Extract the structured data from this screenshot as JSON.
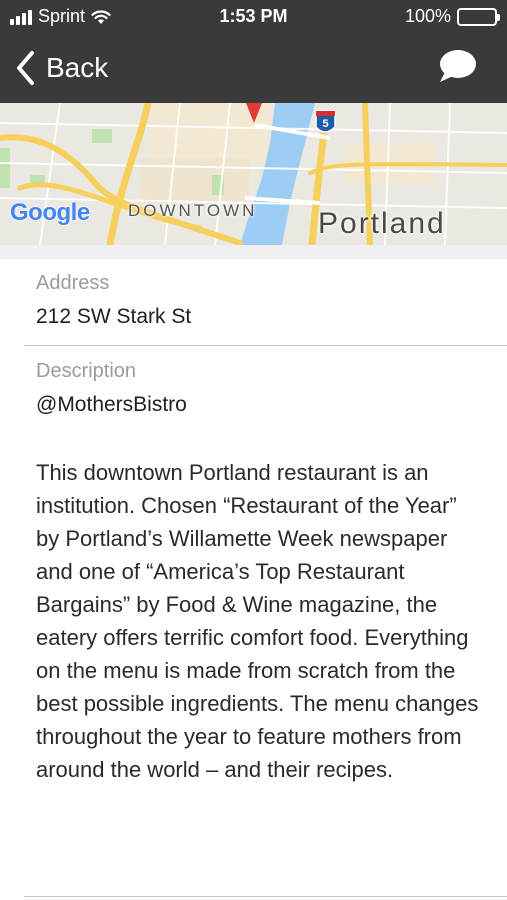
{
  "status_bar": {
    "carrier": "Sprint",
    "time": "1:53 PM",
    "battery": "100%"
  },
  "nav": {
    "back_label": "Back",
    "back_icon": "chevron-left-icon",
    "chat_icon": "speech-bubble-icon"
  },
  "map": {
    "provider_logo": "Google",
    "district_label": "DOWNTOWN",
    "city_label": "Portland",
    "highway_shield": "5"
  },
  "details": {
    "address_label": "Address",
    "address_value": "212 SW Stark St",
    "description_label": "Description",
    "handle": "@MothersBistro",
    "description": "This downtown Portland restaurant is an institution. Chosen “Restaurant of the Year” by Portland’s Willamette Week newspaper and one of “America’s Top Restaurant Bargains” by Food & Wine magazine, the eatery offers terrific comfort food. Everything on the menu is made from scratch from the best possible ingredients. The menu changes throughout the year to feature mothers from around the world – and their recipes."
  },
  "colors": {
    "nav_bg": "#3a3a3a",
    "label_gray": "#9b9b9b",
    "river_blue": "#9ecdf3",
    "road_yellow": "#f6cf5c"
  }
}
